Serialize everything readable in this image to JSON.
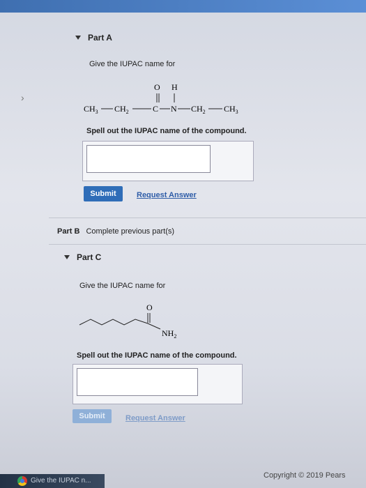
{
  "partA": {
    "header": "Part A",
    "prompt": "Give the IUPAC name for",
    "structure": {
      "top_o": "O",
      "top_h": "H",
      "ch3": "CH",
      "ch3_sub": "3",
      "ch2": "CH",
      "ch2_sub": "2",
      "c": "C",
      "n": "N",
      "ch2b": "CH",
      "ch2b_sub": "2",
      "ch3b": "CH",
      "ch3b_sub": "3"
    },
    "instruction": "Spell out the IUPAC name of the compound.",
    "answer_value": "",
    "submit_label": "Submit",
    "request_label": "Request Answer"
  },
  "partB": {
    "label": "Part B",
    "status": "Complete previous part(s)"
  },
  "partC": {
    "header": "Part C",
    "prompt": "Give the IUPAC name for",
    "structure": {
      "o": "O",
      "nh": "NH",
      "nh_sub": "2"
    },
    "instruction": "Spell out the IUPAC name of the compound.",
    "answer_value": "",
    "submit_label": "Submit",
    "request_label": "Request Answer"
  },
  "footer": {
    "copyright": "Copyright © 2019 Pears"
  },
  "taskbar": {
    "tab_label": "Give the IUPAC n..."
  },
  "colors": {
    "button": "#2f6db8",
    "link": "#2f5da8"
  }
}
